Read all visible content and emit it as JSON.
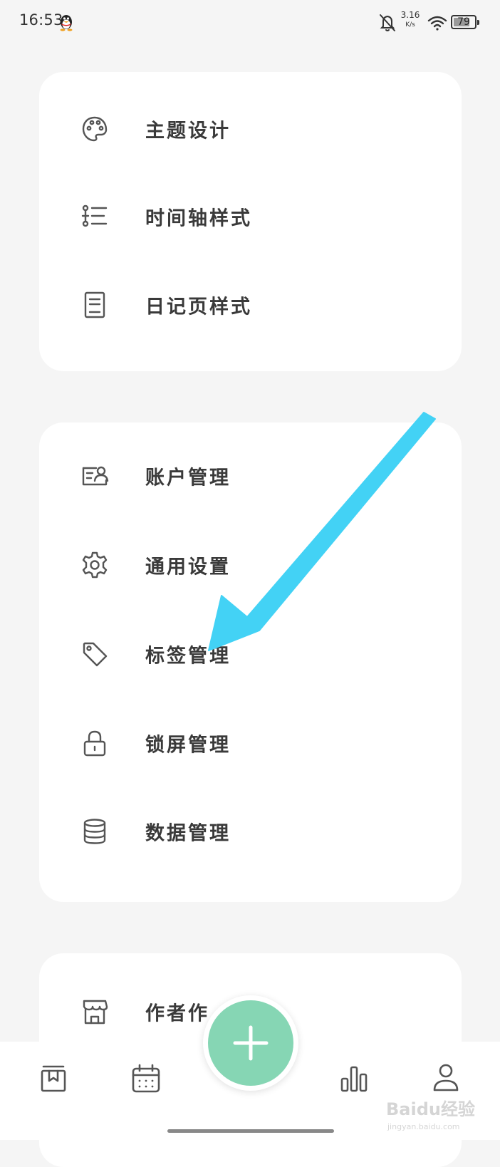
{
  "status_bar": {
    "time": "16:53",
    "net_speed_value": "3.16",
    "net_speed_unit": "K/s",
    "battery_level": "79",
    "icons": [
      "qq-icon",
      "bell-off-icon",
      "wifi-icon",
      "battery-icon"
    ]
  },
  "appearance_section": {
    "items": [
      {
        "label": "主题设计",
        "icon": "palette-icon"
      },
      {
        "label": "时间轴样式",
        "icon": "timeline-list-icon"
      },
      {
        "label": "日记页样式",
        "icon": "document-page-icon"
      }
    ]
  },
  "management_section": {
    "items": [
      {
        "label": "账户管理",
        "icon": "account-card-icon"
      },
      {
        "label": "通用设置",
        "icon": "gear-icon"
      },
      {
        "label": "标签管理",
        "icon": "tag-icon"
      },
      {
        "label": "锁屏管理",
        "icon": "lock-icon"
      },
      {
        "label": "数据管理",
        "icon": "database-icon"
      }
    ]
  },
  "about_section": {
    "items": [
      {
        "label": "作者作",
        "icon": "store-icon"
      }
    ]
  },
  "bottom_nav": {
    "items": [
      {
        "icon": "diary-book-icon"
      },
      {
        "icon": "calendar-icon"
      },
      {
        "icon": "add-icon"
      },
      {
        "icon": "bar-chart-icon"
      },
      {
        "icon": "profile-icon"
      }
    ]
  },
  "colors": {
    "background": "#f5f5f5",
    "card": "#ffffff",
    "fab": "#86d6b4",
    "annotation_arrow": "#43d2f5",
    "icon_stroke": "#555555"
  },
  "watermark": {
    "text": "Baidu经验",
    "subtext": "jingyan.baidu.com"
  }
}
